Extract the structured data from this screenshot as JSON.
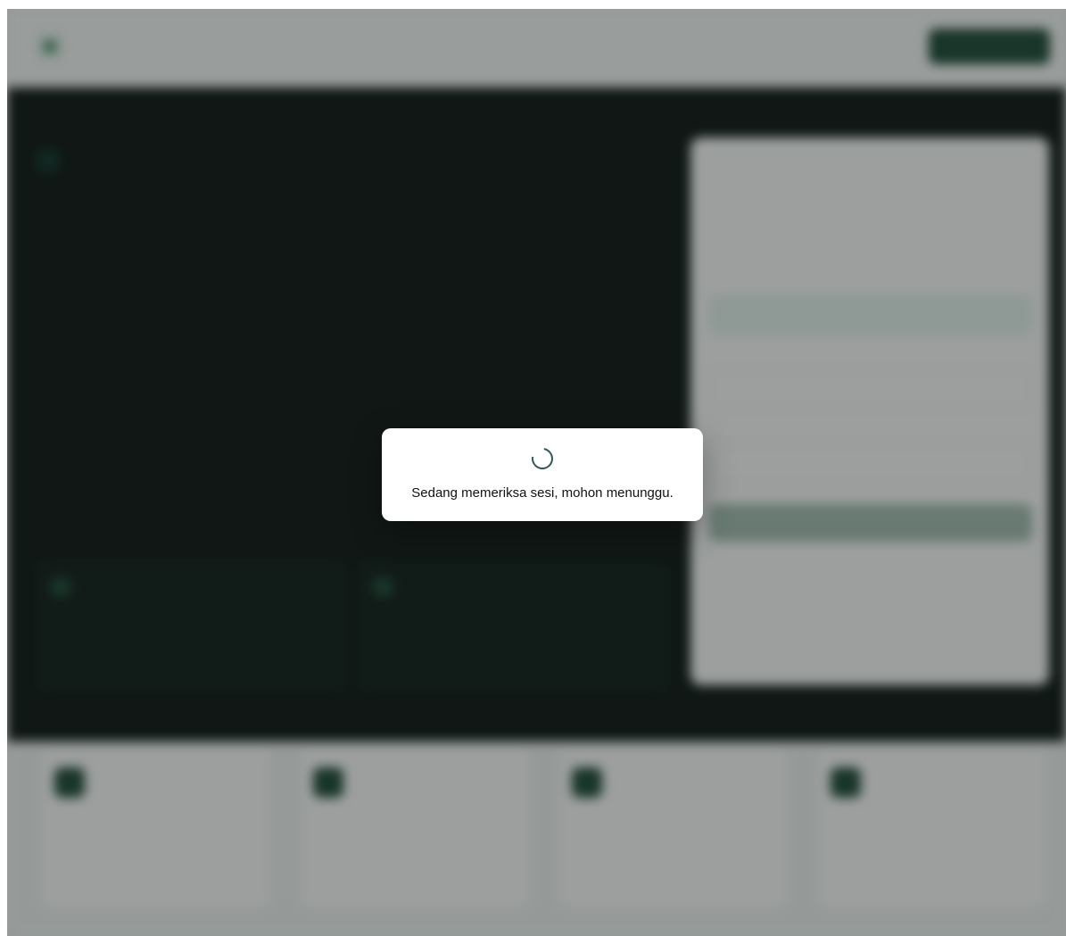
{
  "dialog": {
    "message": "Sedang memeriksa sesi, mohon menunggu.",
    "icon": "spinner-icon"
  },
  "colors": {
    "overlay": "#141a18",
    "hero_background": "#0e1614",
    "accent": "#1f4a37",
    "spinner": "#2f5a5a"
  }
}
